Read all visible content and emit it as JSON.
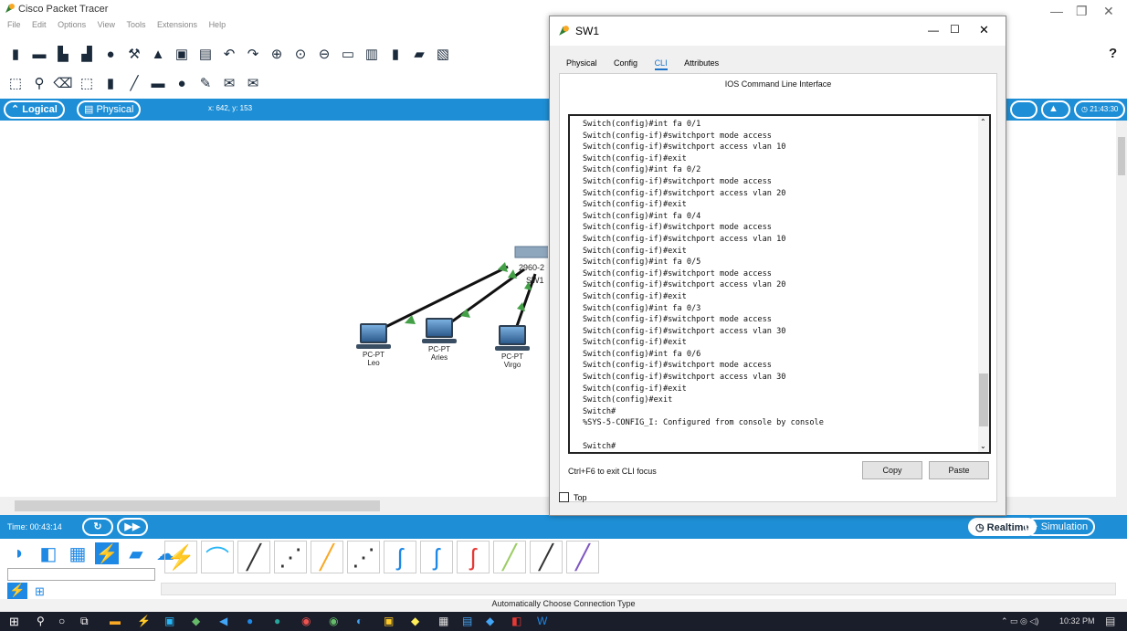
{
  "app": {
    "title": "Cisco Packet Tracer",
    "menu": [
      "File",
      "Edit",
      "Options",
      "View",
      "Tools",
      "Extensions",
      "Help"
    ],
    "help_icon": "?"
  },
  "workspace": {
    "logical_tab": "Logical",
    "physical_tab": "Physical",
    "coords": "x: 642, y: 153",
    "clock": "21:43:30",
    "devices": [
      {
        "type": "PC-PT",
        "name": "Leo"
      },
      {
        "type": "PC-PT",
        "name": "Aries"
      },
      {
        "type": "PC-PT",
        "name": "Virgo"
      }
    ],
    "switch_label_a": "2960-2",
    "switch_label_b": "SW1"
  },
  "timebar": {
    "time": "Time: 00:43:14",
    "realtime": "Realtime",
    "simulation": "Simulation"
  },
  "status_text": "Automatically Choose Connection Type",
  "taskbar": {
    "time": "10:32 PM"
  },
  "dialog": {
    "title": "SW1",
    "tabs": [
      "Physical",
      "Config",
      "CLI",
      "Attributes"
    ],
    "active_tab": "CLI",
    "cli_header": "IOS Command Line Interface",
    "cli_lines": [
      "Switch(config)#int fa 0/1",
      "Switch(config-if)#switchport mode access",
      "Switch(config-if)#switchport access vlan 10",
      "Switch(config-if)#exit",
      "Switch(config)#int fa 0/2",
      "Switch(config-if)#switchport mode access",
      "Switch(config-if)#switchport access vlan 20",
      "Switch(config-if)#exit",
      "Switch(config)#int fa 0/4",
      "Switch(config-if)#switchport mode access",
      "Switch(config-if)#switchport access vlan 10",
      "Switch(config-if)#exit",
      "Switch(config)#int fa 0/5",
      "Switch(config-if)#switchport mode access",
      "Switch(config-if)#switchport access vlan 20",
      "Switch(config-if)#exit",
      "Switch(config)#int fa 0/3",
      "Switch(config-if)#switchport mode access",
      "Switch(config-if)#switchport access vlan 30",
      "Switch(config-if)#exit",
      "Switch(config)#int fa 0/6",
      "Switch(config-if)#switchport mode access",
      "Switch(config-if)#switchport access vlan 30",
      "Switch(config-if)#exit",
      "Switch(config)#exit",
      "Switch#",
      "%SYS-5-CONFIG_I: Configured from console by console",
      "",
      "Switch#"
    ],
    "focus_hint": "Ctrl+F6 to exit CLI focus",
    "copy_label": "Copy",
    "paste_label": "Paste",
    "top_label": "Top"
  },
  "colors": {
    "bar_blue": "#1e8fd6",
    "link_green": "#4caf50",
    "active_tab": "#1a73c8"
  }
}
